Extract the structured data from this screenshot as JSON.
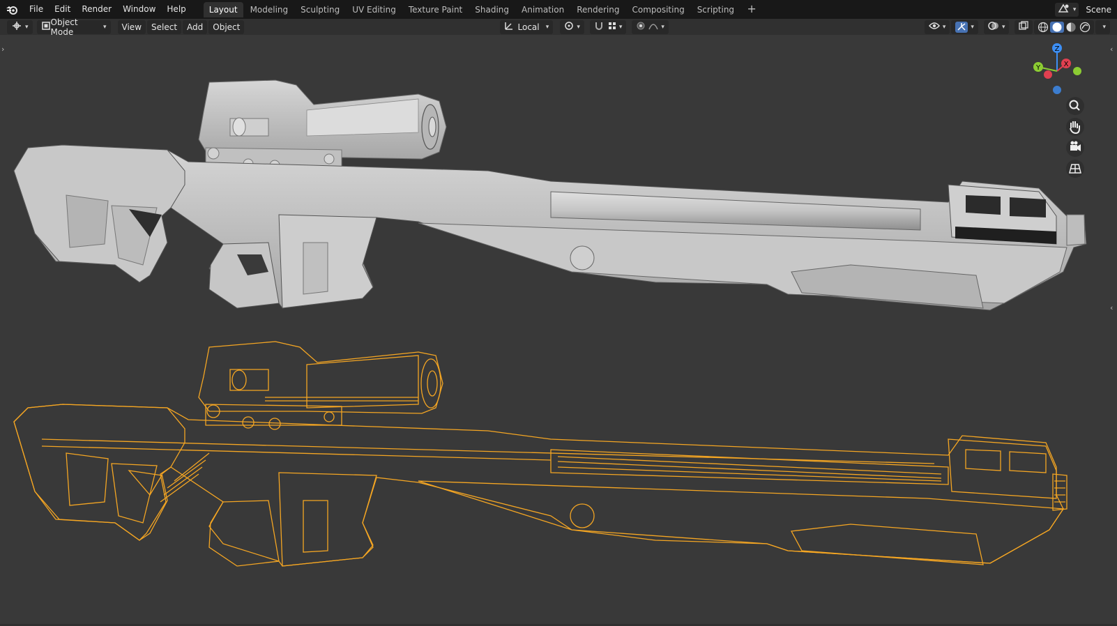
{
  "topbar": {
    "menus": [
      "File",
      "Edit",
      "Render",
      "Window",
      "Help"
    ],
    "tabs": [
      "Layout",
      "Modeling",
      "Sculpting",
      "UV Editing",
      "Texture Paint",
      "Shading",
      "Animation",
      "Rendering",
      "Compositing",
      "Scripting"
    ],
    "active_tab": "Layout",
    "scene_label": "Scene"
  },
  "header": {
    "mode": "Object Mode",
    "menus": [
      "View",
      "Select",
      "Add",
      "Object"
    ],
    "transform_orientation": "Local"
  },
  "gizmo": {
    "x": "X",
    "y": "Y",
    "z": "Z"
  },
  "colors": {
    "wire": "#f5a623",
    "solid": "#c8c8c8",
    "viewport_bg": "#393939",
    "x_axis": "#e04050",
    "y_axis": "#8ccc33",
    "z_axis": "#3d8ff5"
  }
}
